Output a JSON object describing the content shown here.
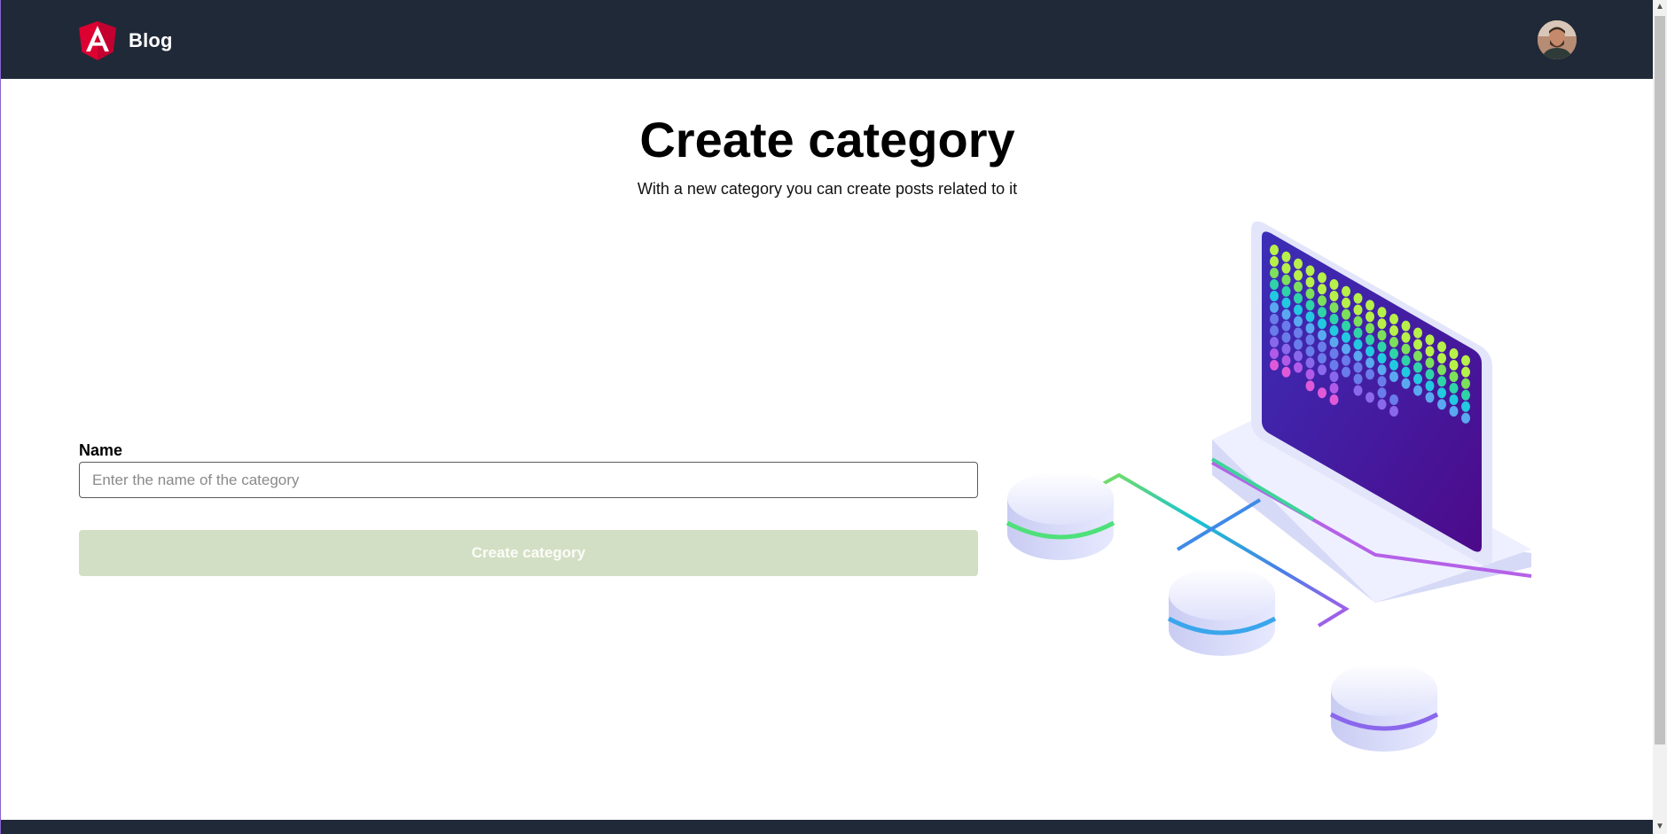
{
  "navbar": {
    "brand_label": "Blog",
    "logo_icon": "angular-logo-icon",
    "avatar_icon": "user-avatar",
    "background": "#202938"
  },
  "header": {
    "title": "Create category",
    "subtitle": "With a new category you can create posts related to it"
  },
  "form": {
    "name_label": "Name",
    "name_value": "",
    "name_placeholder": "Enter the name of the category",
    "submit_label": "Create category",
    "submit_disabled": true,
    "submit_color": "#d3dfc4"
  },
  "illustration": {
    "icon": "database-network-illustration"
  },
  "colors": {
    "brand_red": "#dd0031",
    "illustration_screen": "#4a1aa8"
  }
}
